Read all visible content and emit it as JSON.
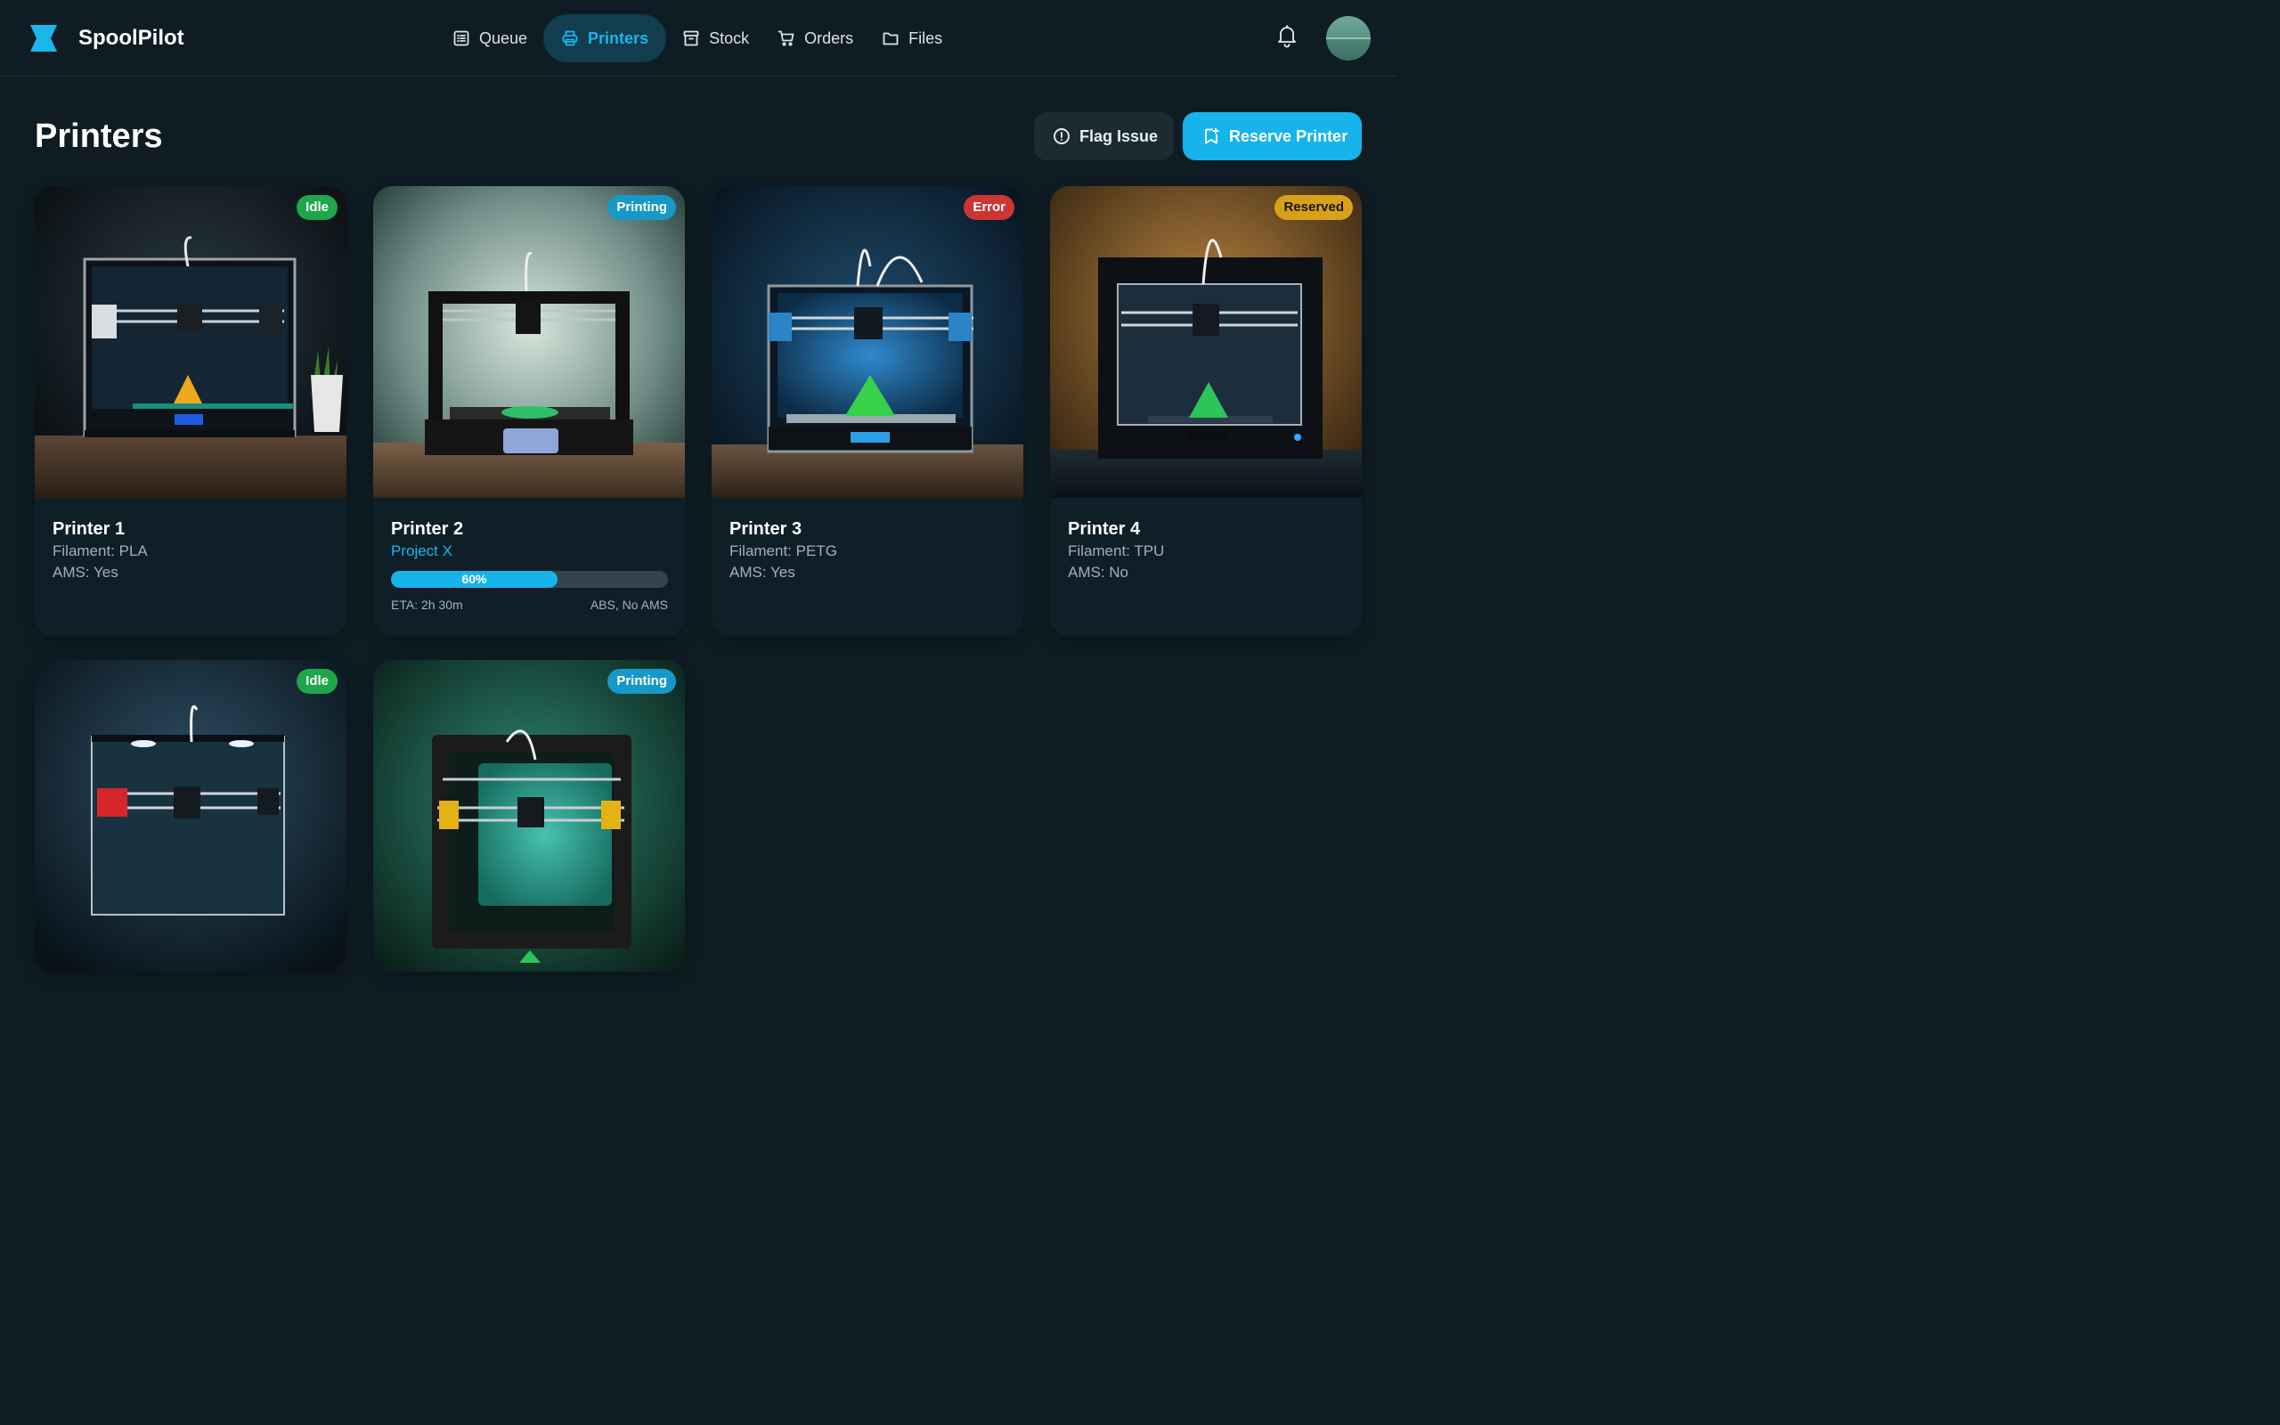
{
  "app": {
    "brand": "SpoolPilot",
    "icons": {
      "logo": "spool-logo-icon",
      "bell": "bell-icon",
      "avatar": "user-avatar"
    },
    "accent": "#16b4ea"
  },
  "nav": {
    "items": [
      {
        "label": "Queue",
        "icon": "list-icon",
        "active": false
      },
      {
        "label": "Printers",
        "icon": "printer-icon",
        "active": true
      },
      {
        "label": "Stock",
        "icon": "archive-box-icon",
        "active": false
      },
      {
        "label": "Orders",
        "icon": "cart-icon",
        "active": false
      },
      {
        "label": "Files",
        "icon": "folder-icon",
        "active": false
      }
    ]
  },
  "page": {
    "title": "Printers",
    "flag_button": "Flag Issue",
    "reserve_button": "Reserve Printer"
  },
  "printers": [
    {
      "name": "Printer 1",
      "status": "Idle",
      "status_color": "#1ea64a",
      "line1": "Filament: PLA",
      "line2": "AMS: Yes",
      "print_color": "#f0a81d"
    },
    {
      "name": "Printer 2",
      "status": "Printing",
      "status_color": "#1798c6",
      "project": "Project X",
      "progress": 0.6,
      "progress_label": "60%",
      "eta": "ETA: 2h 30m",
      "info": "ABS, No AMS",
      "print_color": "#2fbf6b"
    },
    {
      "name": "Printer 3",
      "status": "Error",
      "status_color": "#cd3535",
      "line1": "Filament: PETG",
      "line2": "AMS: Yes",
      "print_color": "#38d14a"
    },
    {
      "name": "Printer 4",
      "status": "Reserved",
      "status_color": "#d7a21a",
      "line1": "Filament: TPU",
      "line2": "AMS: No",
      "print_color": "#2bc55a"
    },
    {
      "name": "",
      "status": "Idle",
      "status_color": "#1ea64a"
    },
    {
      "name": "",
      "status": "Printing",
      "status_color": "#1798c6",
      "print_color": "#2bc55a"
    }
  ]
}
